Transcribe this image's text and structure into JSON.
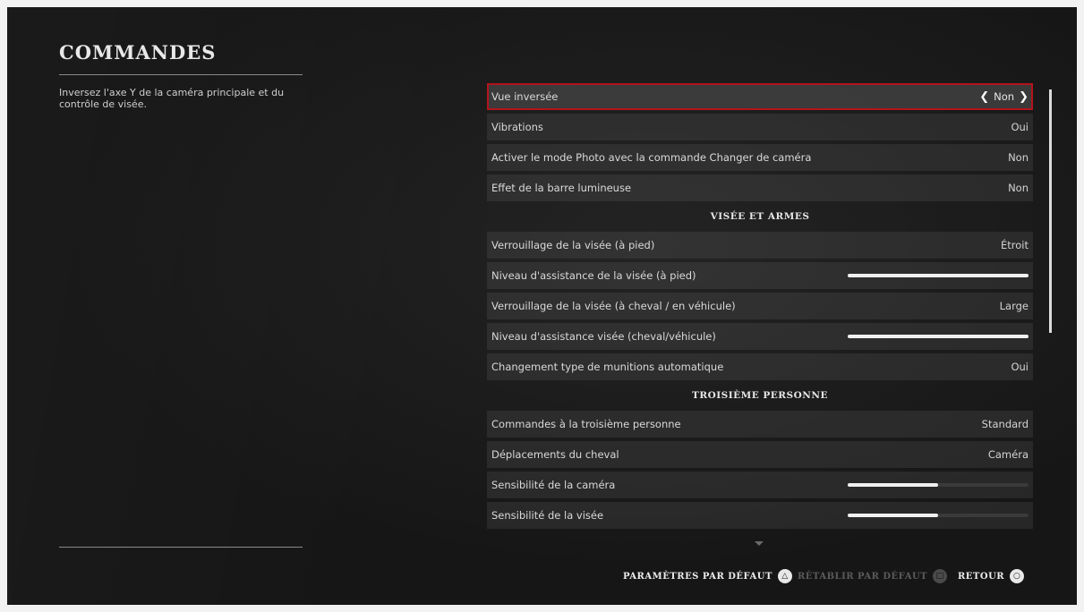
{
  "page": {
    "title": "COMMANDES",
    "description": "Inversez l'axe Y de la caméra principale et du contrôle de visée."
  },
  "settings": {
    "rows": [
      {
        "label": "Vue inversée",
        "value": "Non",
        "selected": true
      },
      {
        "label": "Vibrations",
        "value": "Oui"
      },
      {
        "label": "Activer le mode Photo avec la commande Changer de caméra",
        "value": "Non"
      },
      {
        "label": "Effet de la barre lumineuse",
        "value": "Non"
      }
    ],
    "section_aim": "VISÉE ET ARMES",
    "aim_rows": [
      {
        "label": "Verrouillage de la visée (à pied)",
        "value": "Étroit"
      },
      {
        "label": "Niveau d'assistance de la visée (à pied)",
        "slider_level": 1.0
      },
      {
        "label": "Verrouillage de la visée (à cheval / en véhicule)",
        "value": "Large"
      },
      {
        "label": "Niveau d'assistance visée (cheval/véhicule)",
        "slider_level": 1.0
      },
      {
        "label": "Changement type de munitions automatique",
        "value": "Oui"
      }
    ],
    "section_third": "TROISIÈME PERSONNE",
    "third_rows": [
      {
        "label": "Commandes à la troisième personne",
        "value": "Standard"
      },
      {
        "label": "Déplacements du cheval",
        "value": "Caméra"
      },
      {
        "label": "Sensibilité de la caméra",
        "slider_level": 0.5
      },
      {
        "label": "Sensibilité de la visée",
        "slider_level": 0.5
      }
    ]
  },
  "footer": {
    "defaults_label": "PARAMÈTRES PAR DÉFAUT",
    "defaults_icon": "triangle-button-icon",
    "restore_label": "RÉTABLIR PAR DÉFAUT",
    "restore_icon": "square-button-icon",
    "back_label": "RETOUR",
    "back_icon": "circle-button-icon"
  },
  "colors": {
    "selection_border": "#b3141b",
    "background": "#161616"
  }
}
